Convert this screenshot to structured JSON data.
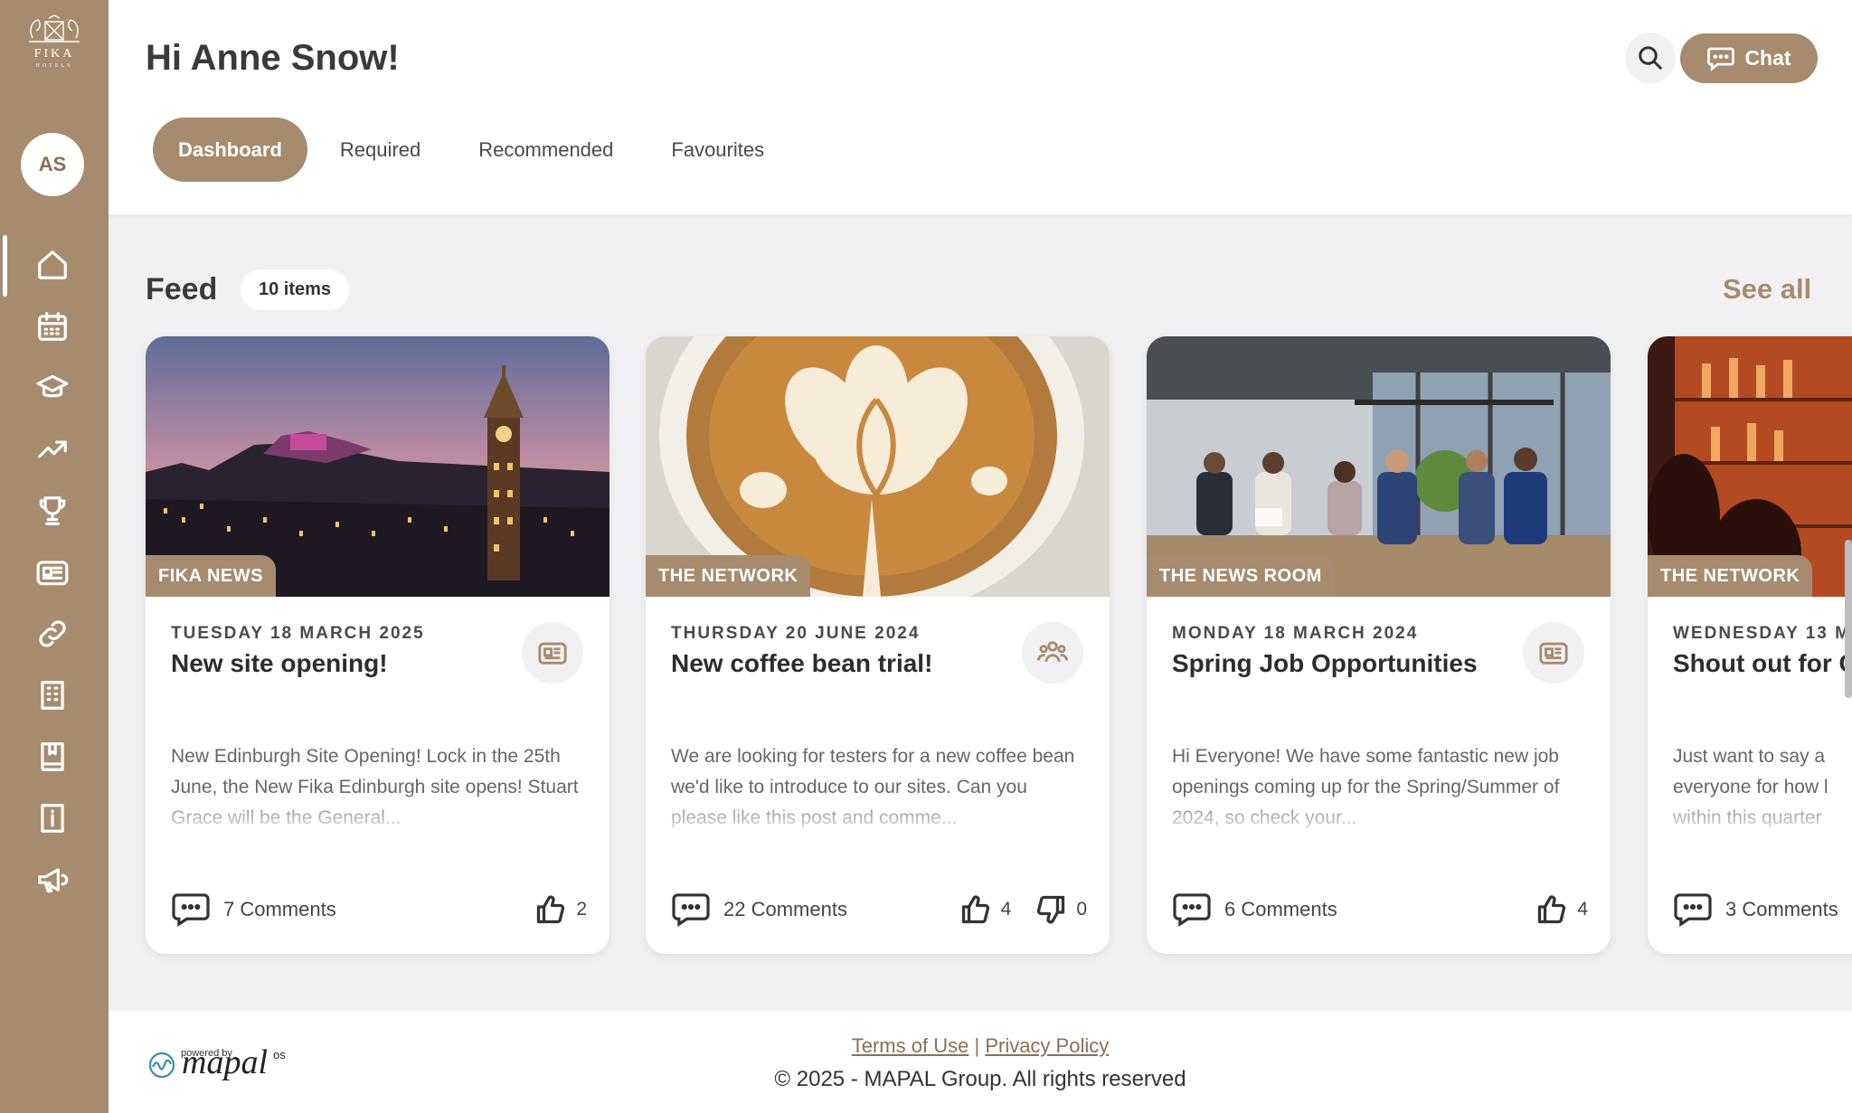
{
  "brand": {
    "logo_word": "FIKA",
    "logo_sub": "HOTELS",
    "accent": "#a78b6e"
  },
  "user": {
    "initials": "AS",
    "greeting": "Hi Anne Snow!"
  },
  "header": {
    "chat_label": "Chat"
  },
  "tabs": [
    {
      "label": "Dashboard",
      "active": true
    },
    {
      "label": "Required"
    },
    {
      "label": "Recommended"
    },
    {
      "label": "Favourites"
    }
  ],
  "sidebar": {
    "items": [
      {
        "icon": "home-icon",
        "active": true
      },
      {
        "icon": "calendar-icon"
      },
      {
        "icon": "graduation-cap-icon"
      },
      {
        "icon": "trending-up-icon"
      },
      {
        "icon": "trophy-icon"
      },
      {
        "icon": "news-icon"
      },
      {
        "icon": "link-icon"
      },
      {
        "icon": "building-icon"
      },
      {
        "icon": "book-icon"
      },
      {
        "icon": "info-icon"
      },
      {
        "icon": "megaphone-icon"
      }
    ]
  },
  "feed": {
    "title": "Feed",
    "count": "10 items",
    "see_all": "See all",
    "cards": [
      {
        "tag": "FIKA NEWS",
        "date": "TUESDAY 18 MARCH 2025",
        "title": "New site opening!",
        "type_icon": "news-icon",
        "excerpt": "New Edinburgh Site Opening!  Lock in the 25th June, the New Fika Edinburgh site opens! Stuart Grace will be the General...",
        "comments": "7 Comments",
        "likes": "2",
        "dislikes": null
      },
      {
        "tag": "THE NETWORK",
        "date": "THURSDAY 20 JUNE 2024",
        "title": "New coffee bean trial!",
        "type_icon": "people-icon",
        "excerpt": "We are looking for testers for a new coffee bean we'd like to introduce to our sites. Can you please like this post and comme...",
        "comments": "22 Comments",
        "likes": "4",
        "dislikes": "0"
      },
      {
        "tag": "THE NEWS ROOM",
        "date": "MONDAY 18 MARCH 2024",
        "title": "Spring Job Opportunities",
        "type_icon": "news-icon",
        "excerpt": "Hi Everyone! We have some fantastic new job openings coming up for the Spring/Summer of 2024, so check your...",
        "comments": "6 Comments",
        "likes": "4",
        "dislikes": null
      },
      {
        "tag": "THE NETWORK",
        "date": "WEDNESDAY 13 M",
        "title": "Shout out for C",
        "type_icon": "people-icon",
        "excerpt": "Just want to say a everyone for how l within this quarter",
        "comments": "3 Comments",
        "likes": null,
        "dislikes": null
      }
    ]
  },
  "footer": {
    "powered_by": "powered by",
    "mapal": "mapal",
    "mapal_os": "os",
    "terms": "Terms of Use",
    "separator": "|",
    "privacy": "Privacy Policy",
    "copyright": "© 2025 - MAPAL Group. All rights reserved"
  }
}
